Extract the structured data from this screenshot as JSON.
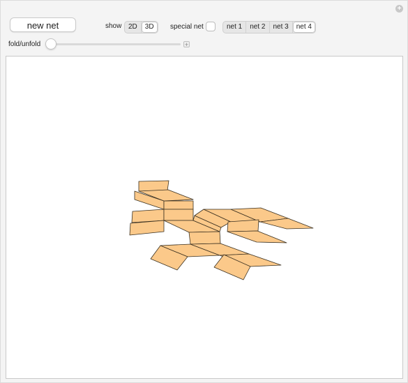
{
  "controls": {
    "new_net_label": "new net",
    "show_label": "show",
    "show_options": [
      "2D",
      "3D"
    ],
    "show_selected": "3D",
    "special_net_label": "special net",
    "special_net_checked": false,
    "net_options": [
      "net 1",
      "net 2",
      "net 3",
      "net 4"
    ],
    "net_selected": "net 4",
    "fold_label": "fold/unfold",
    "fold_value": 0
  },
  "colors": {
    "face_fill": "#fbc98a",
    "face_stroke": "#3a3020",
    "canvas_bg": "#ffffff",
    "panel_bg": "#f4f4f4"
  },
  "icons": {
    "corner": "plus-circle-icon",
    "slider_expand": "plus-square-icon"
  }
}
